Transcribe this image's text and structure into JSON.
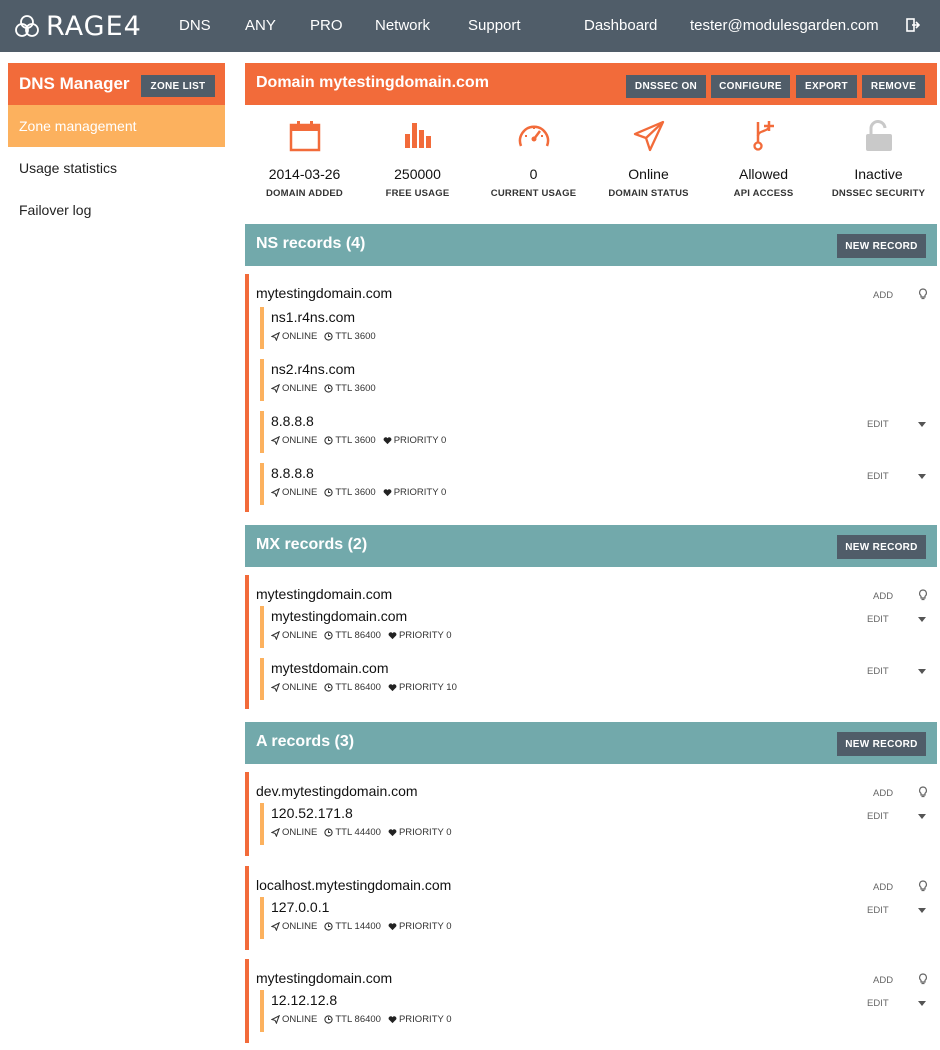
{
  "nav": {
    "brand": "RAGE4",
    "items": [
      "DNS",
      "ANY",
      "PRO",
      "Network",
      "Support"
    ],
    "dashboard": "Dashboard",
    "user": "tester@modulesgarden.com"
  },
  "sidebar": {
    "title": "DNS Manager",
    "zone_list_label": "ZONE LIST",
    "items": [
      {
        "label": "Zone management",
        "active": true
      },
      {
        "label": "Usage statistics",
        "active": false
      },
      {
        "label": "Failover log",
        "active": false
      }
    ]
  },
  "domain": {
    "title": "Domain mytestingdomain.com",
    "buttons": [
      "DNSSEC ON",
      "CONFIGURE",
      "EXPORT",
      "REMOVE"
    ]
  },
  "stats": [
    {
      "icon": "calendar-icon",
      "value": "2014-03-26",
      "label": "DOMAIN ADDED"
    },
    {
      "icon": "bar-chart-icon",
      "value": "250000",
      "label": "FREE USAGE"
    },
    {
      "icon": "speedometer-icon",
      "value": "0",
      "label": "CURRENT USAGE"
    },
    {
      "icon": "paper-plane-icon",
      "value": "Online",
      "label": "DOMAIN STATUS"
    },
    {
      "icon": "branch-icon",
      "value": "Allowed",
      "label": "API ACCESS"
    },
    {
      "icon": "unlock-icon",
      "value": "Inactive",
      "label": "DNSSEC SECURITY"
    }
  ],
  "colors": {
    "accent": "#f26b3a",
    "accent_light": "#fcb15e",
    "nav": "#505d69",
    "section": "#72a9ab"
  },
  "labels": {
    "new_record": "NEW RECORD",
    "add": "ADD",
    "edit": "EDIT",
    "online": "ONLINE"
  },
  "sections": [
    {
      "title": "NS records (4)",
      "zones": [
        {
          "name": "mytestingdomain.com",
          "records": [
            {
              "value": "ns1.r4ns.com",
              "status": "ONLINE",
              "ttl": "TTL 3600",
              "priority": "",
              "editable": false
            },
            {
              "value": "ns2.r4ns.com",
              "status": "ONLINE",
              "ttl": "TTL 3600",
              "priority": "",
              "editable": false
            },
            {
              "value": "8.8.8.8",
              "status": "ONLINE",
              "ttl": "TTL 3600",
              "priority": "PRIORITY 0",
              "editable": true
            },
            {
              "value": "8.8.8.8",
              "status": "ONLINE",
              "ttl": "TTL 3600",
              "priority": "PRIORITY 0",
              "editable": true
            }
          ]
        }
      ]
    },
    {
      "title": "MX records (2)",
      "zones": [
        {
          "name": "mytestingdomain.com",
          "records": [
            {
              "value": "mytestingdomain.com",
              "status": "ONLINE",
              "ttl": "TTL 86400",
              "priority": "PRIORITY 0",
              "editable": true
            },
            {
              "value": "mytestdomain.com",
              "status": "ONLINE",
              "ttl": "TTL 86400",
              "priority": "PRIORITY 10",
              "editable": true
            }
          ]
        }
      ]
    },
    {
      "title": "A records (3)",
      "zones": [
        {
          "name": "dev.mytestingdomain.com",
          "records": [
            {
              "value": "120.52.171.8",
              "status": "ONLINE",
              "ttl": "TTL 44400",
              "priority": "PRIORITY 0",
              "editable": true
            }
          ]
        },
        {
          "name": "localhost.mytestingdomain.com",
          "records": [
            {
              "value": "127.0.0.1",
              "status": "ONLINE",
              "ttl": "TTL 14400",
              "priority": "PRIORITY 0",
              "editable": true
            }
          ]
        },
        {
          "name": "mytestingdomain.com",
          "records": [
            {
              "value": "12.12.12.8",
              "status": "ONLINE",
              "ttl": "TTL 86400",
              "priority": "PRIORITY 0",
              "editable": true
            }
          ]
        }
      ]
    }
  ]
}
